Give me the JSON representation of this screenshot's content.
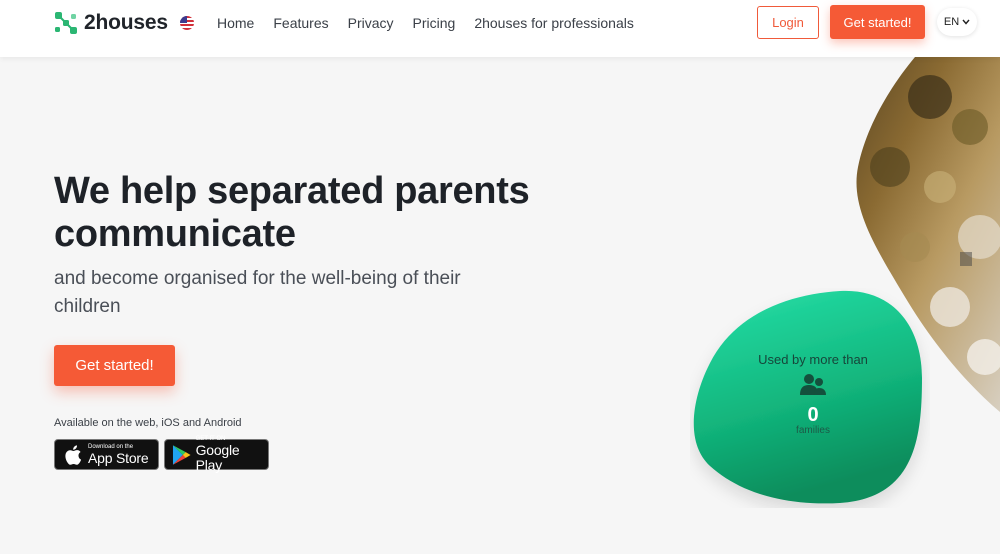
{
  "brand": {
    "name": "2houses"
  },
  "nav": {
    "items": [
      "Home",
      "Features",
      "Privacy",
      "Pricing",
      "2houses for professionals"
    ]
  },
  "header": {
    "login_label": "Login",
    "get_started_label": "Get started!",
    "language": "EN"
  },
  "hero": {
    "title": "We help separated parents communicate",
    "subtitle": "and become organised for the well-being of their children",
    "cta_label": "Get started!",
    "availability": "Available on the web, iOS and Android"
  },
  "stores": {
    "apple_small": "Download on the",
    "apple_large": "App Store",
    "google_small": "GET IT ON",
    "google_large": "Google Play"
  },
  "stats": {
    "label": "Used by more than",
    "count": "0",
    "unit": "families"
  },
  "colors": {
    "accent": "#f55a36",
    "brand_green": "#2bb673",
    "stat_green": "#1fc88e"
  },
  "icons": [
    "logo-mark-icon",
    "us-flag-icon",
    "chevron-down-icon",
    "apple-icon",
    "google-play-icon",
    "users-icon"
  ]
}
